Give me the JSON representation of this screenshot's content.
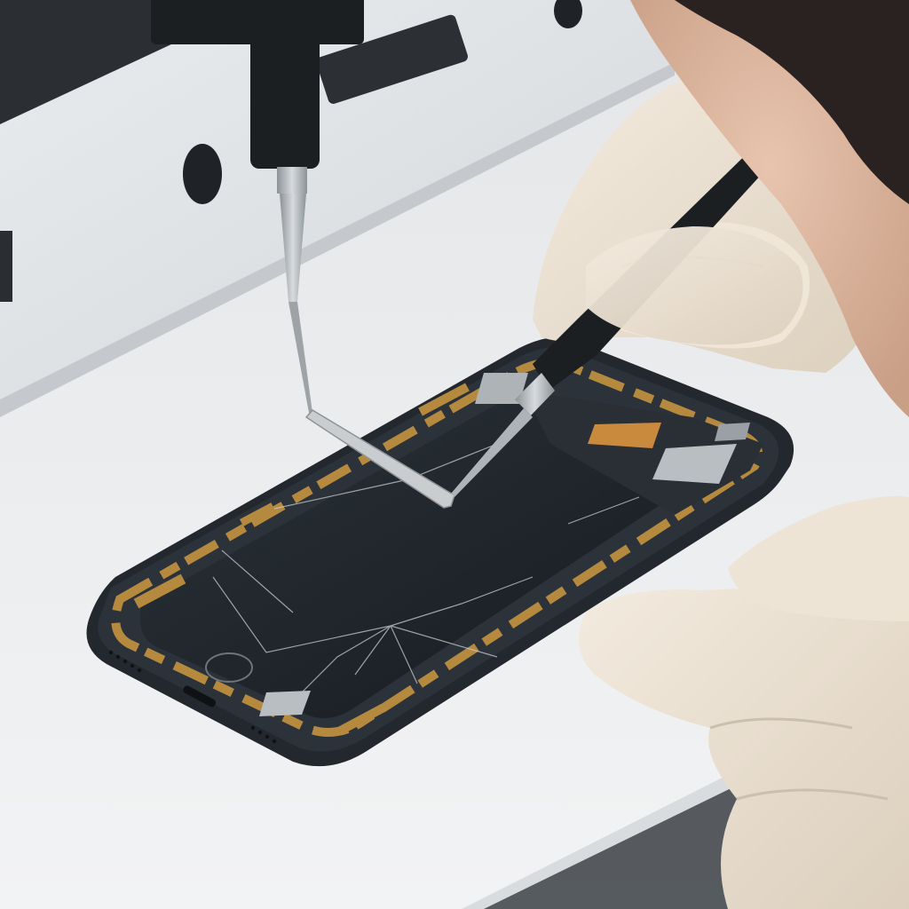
{
  "scene": {
    "subject": "smartphone-repair",
    "colors": {
      "bench": "#ecedee",
      "machine": "#dfe2e5",
      "phone_frame": "#23282e",
      "glass": "#1d2329",
      "gold": "#b58a3e",
      "copper": "#c98a3d",
      "shield": "#b9bec3",
      "glove": "#eadfcf",
      "tool": "#1c1f22",
      "steel": "#b4b9bd"
    },
    "icons": [
      "precision-probe",
      "repair-pen-tool",
      "metal-shim"
    ]
  }
}
